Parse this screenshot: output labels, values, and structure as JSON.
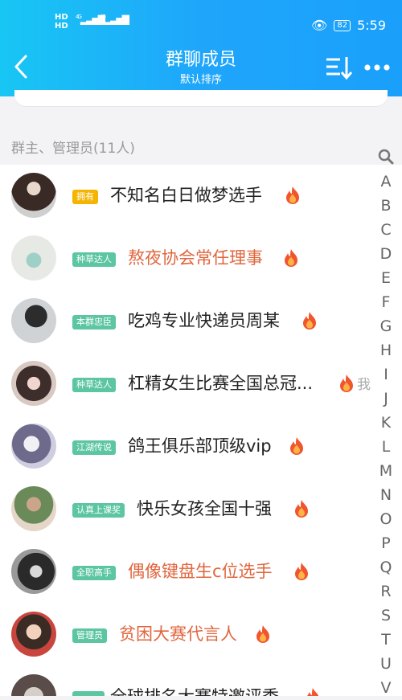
{
  "status_bar": {
    "hd1": "HD",
    "hd2": "HD",
    "sig1": "4G",
    "sig2": "4G",
    "battery": "82",
    "time": "5:59"
  },
  "header": {
    "title": "群聊成员",
    "subtitle": "默认排序"
  },
  "section": {
    "label": "群主、管理员(11人)"
  },
  "members": [
    {
      "badge": "拥有",
      "badge_color": "#f5b400",
      "name": "不知名白日做梦选手",
      "name_color": "#222222"
    },
    {
      "badge": "种草达人",
      "badge_color": "#5cc5a2",
      "name": "熬夜协会常任理事",
      "name_color": "#e0663e"
    },
    {
      "badge": "本群忠臣",
      "badge_color": "#5cc5a2",
      "name": "吃鸡专业快递员周某",
      "name_color": "#222222"
    },
    {
      "badge": "种草达人",
      "badge_color": "#5cc5a2",
      "name": "杠精女生比赛全国总冠...",
      "name_color": "#222222",
      "suffix": "我"
    },
    {
      "badge": "江湖传说",
      "badge_color": "#5cc5a2",
      "name": "鸽王俱乐部顶级vip",
      "name_color": "#222222"
    },
    {
      "badge": "认真上课奖",
      "badge_color": "#5cc5a2",
      "name": "快乐女孩全国十强",
      "name_color": "#222222"
    },
    {
      "badge": "全职高手",
      "badge_color": "#5cc5a2",
      "name": "偶像键盘生c位选手",
      "name_color": "#e0663e"
    },
    {
      "badge": "管理员",
      "badge_color": "#5cc5a2",
      "name": "贫困大赛代言人",
      "name_color": "#e0663e"
    },
    {
      "badge": "",
      "badge_color": "#5cc5a2",
      "name": "全球排名大赛特邀评委",
      "name_color": "#222222"
    }
  ],
  "index_letters": [
    "A",
    "B",
    "C",
    "D",
    "E",
    "F",
    "G",
    "H",
    "I",
    "J",
    "K",
    "L",
    "M",
    "N",
    "O",
    "P",
    "Q",
    "R",
    "S",
    "T",
    "U",
    "V"
  ],
  "icons": {
    "back": "back-arrow-icon",
    "sort": "sort-icon",
    "more": "more-icon",
    "flame": "flame-icon",
    "search": "search-icon"
  }
}
